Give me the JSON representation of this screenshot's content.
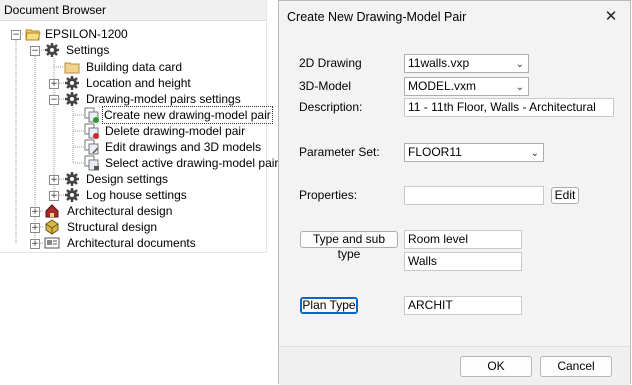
{
  "browser": {
    "title": "Document Browser",
    "root": "EPSILON-1200",
    "settings": "Settings",
    "building_data_card": "Building data card",
    "location_and_height": "Location and height",
    "drawing_model_pairs_settings": "Drawing-model pairs settings",
    "create_pair": "Create new drawing-model pair",
    "delete_pair": "Delete drawing-model pair",
    "edit_drawings": "Edit drawings and 3D models",
    "select_active_pairs": "Select active drawing-model pairs",
    "design_settings": "Design settings",
    "log_house_settings": "Log house settings",
    "architectural_design": "Architectural design",
    "structural_design": "Structural design",
    "architectural_documents": "Architectural documents"
  },
  "dialog": {
    "title": "Create New Drawing-Model Pair",
    "drawing_2d_label": "2D Drawing",
    "drawing_2d_value": "11walls.vxp",
    "model_3d_label": "3D-Model",
    "model_3d_value": "MODEL.vxm",
    "description_label": "Description:",
    "description_value": "11 - 11th Floor, Walls - Architectural",
    "parameter_set_label": "Parameter Set:",
    "parameter_set_value": "FLOOR11",
    "properties_label": "Properties:",
    "properties_value": "",
    "edit_button": "Edit",
    "type_button": "Type and sub type",
    "type_value": "Room level",
    "subtype_value": "Walls",
    "plan_type_button": "Plan Type",
    "plan_type_value": "ARCHIT",
    "ok_button": "OK",
    "cancel_button": "Cancel"
  },
  "colors": {
    "focus_blue": "#0a64c8",
    "dialog_bg": "#f3f3f3"
  }
}
